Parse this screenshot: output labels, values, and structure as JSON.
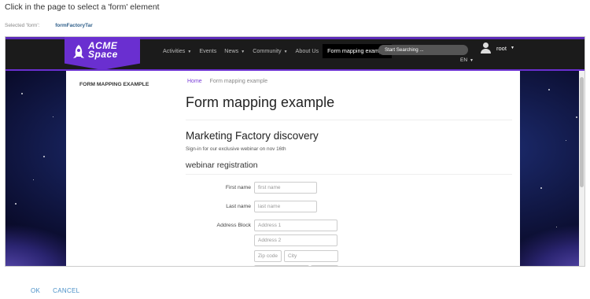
{
  "instruction": "Click in the page to select a 'form' element",
  "selection": {
    "label": "Selected 'form':",
    "value": "formFactoryTar"
  },
  "site": {
    "logo": {
      "line1": "ACME",
      "line2": "Space"
    },
    "nav": [
      {
        "label": "Activities",
        "dropdown": true
      },
      {
        "label": "Events",
        "dropdown": false
      },
      {
        "label": "News",
        "dropdown": true
      },
      {
        "label": "Community",
        "dropdown": true
      },
      {
        "label": "About Us",
        "dropdown": false
      },
      {
        "label": "Form mapping example",
        "dropdown": false,
        "active": true
      }
    ],
    "search_placeholder": "Start Searching ...",
    "user": "root",
    "language": "EN"
  },
  "page": {
    "side_title": "FORM MAPPING EXAMPLE",
    "breadcrumb": {
      "home": "Home",
      "current": "Form mapping example"
    },
    "title": "Form mapping example",
    "subtitle": "Marketing Factory discovery",
    "intro": "Sign-in for our exclusive webinar on nov 16th",
    "section": "webinar registration",
    "form": {
      "first_name": {
        "label": "First name",
        "placeholder": "first name"
      },
      "last_name": {
        "label": "Last name",
        "placeholder": "last name"
      },
      "address": {
        "label": "Address Block",
        "line1": "Address 1",
        "line2": "Address 2",
        "zip": "Zip code",
        "city": "City"
      }
    }
  },
  "dialog": {
    "ok": "OK",
    "cancel": "CANCEL"
  },
  "colors": {
    "accent": "#6a2fd0",
    "link": "#4a90c8"
  }
}
